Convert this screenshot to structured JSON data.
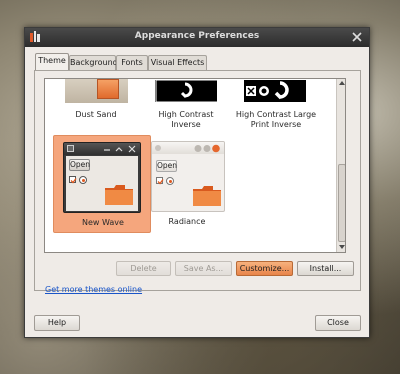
{
  "window": {
    "title": "Appearance Preferences"
  },
  "tabs": [
    {
      "label": "Theme",
      "active": true
    },
    {
      "label": "Background",
      "active": false
    },
    {
      "label": "Fonts",
      "active": false
    },
    {
      "label": "Visual Effects",
      "active": false
    }
  ],
  "themes": {
    "dust_sand": {
      "label": "Dust Sand"
    },
    "high_contrast_inverse": {
      "label_line1": "High Contrast",
      "label_line2": "Inverse"
    },
    "high_contrast_large_print_inverse": {
      "label_line1": "High Contrast Large",
      "label_line2": "Print Inverse"
    },
    "new_wave": {
      "label": "New Wave",
      "selected": true,
      "preview_button": "Open"
    },
    "radiance": {
      "label": "Radiance",
      "preview_button": "Open"
    }
  },
  "actions": {
    "delete": "Delete",
    "save_as": "Save As...",
    "customize": "Customize...",
    "install": "Install..."
  },
  "link_text": "Get more themes online",
  "footer": {
    "help": "Help",
    "close": "Close"
  },
  "colors": {
    "selection": "#f3a57a",
    "accent_orange": "#e8844a",
    "link": "#1a55c8",
    "titlebar": "#3a3a3a"
  }
}
